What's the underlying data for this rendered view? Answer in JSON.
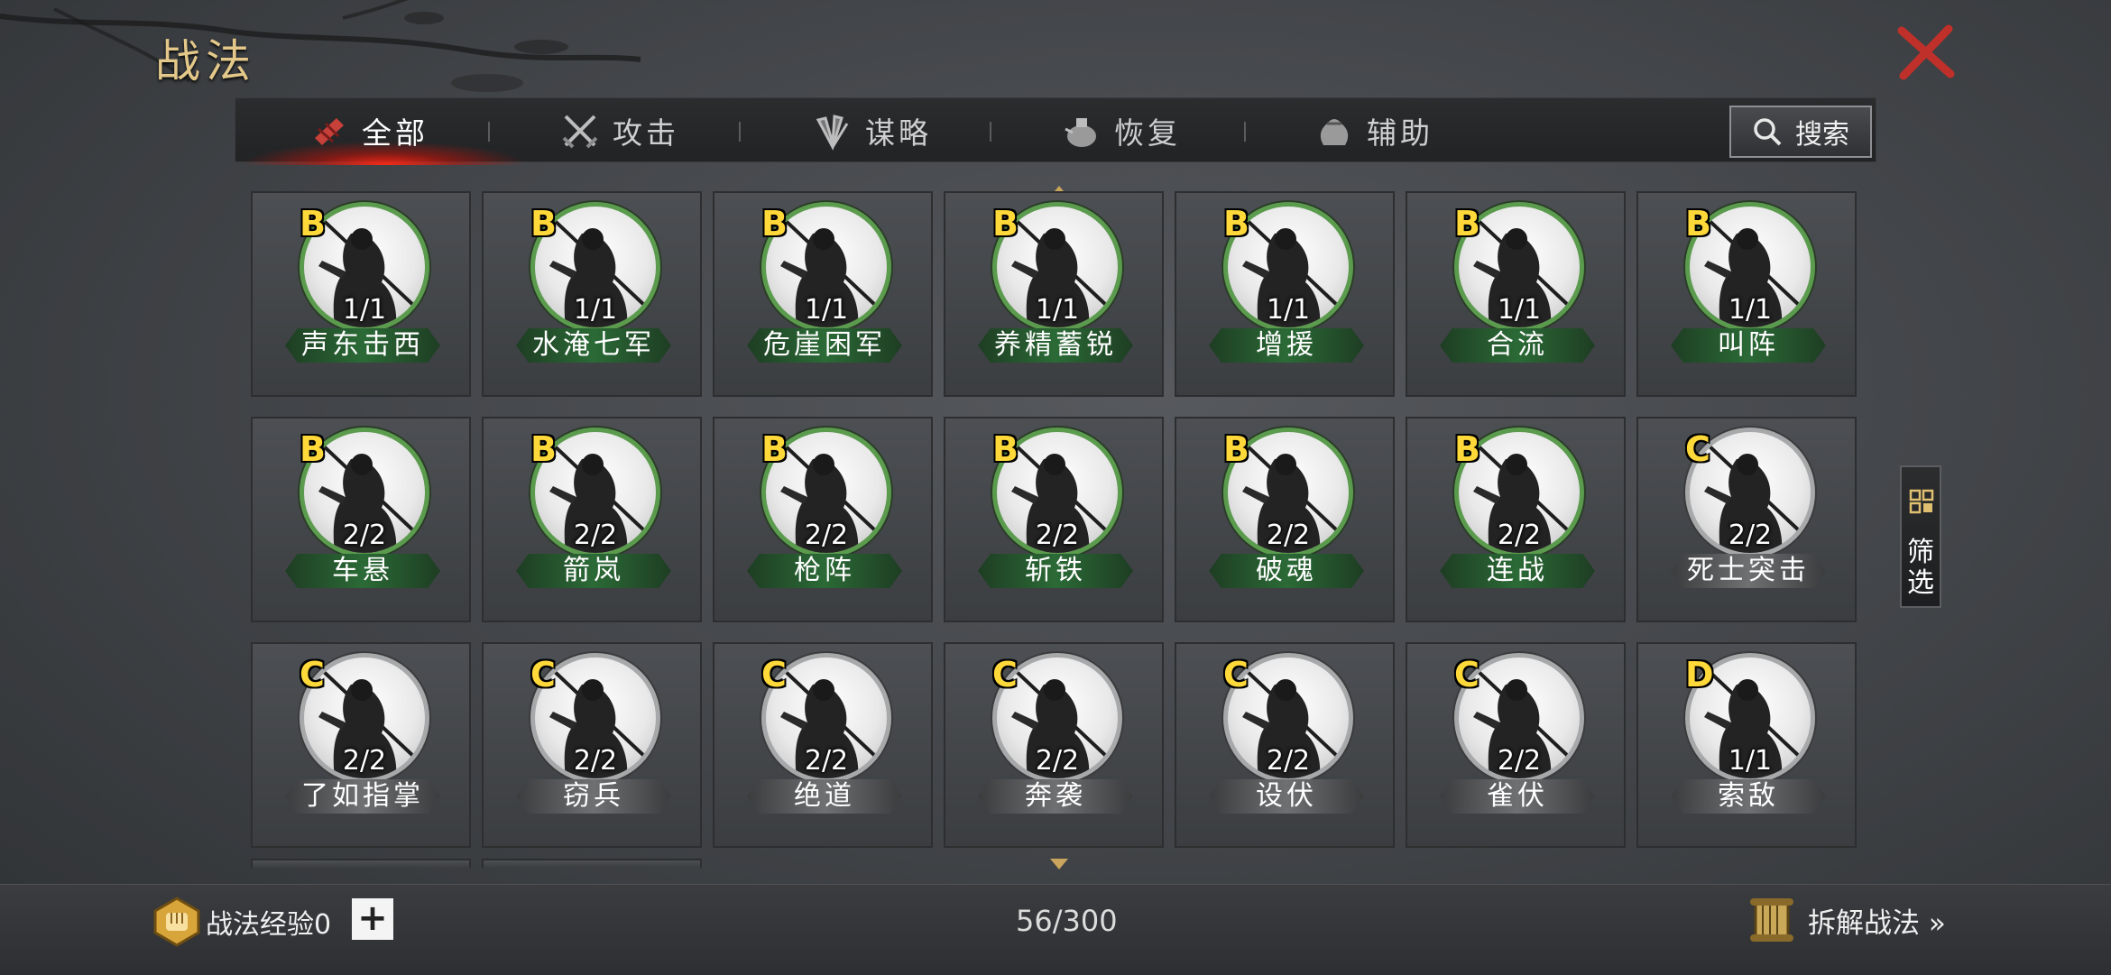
{
  "title": "战法",
  "tabs": [
    {
      "label": "全部",
      "icon": "all-bundle-icon",
      "active": true
    },
    {
      "label": "攻击",
      "icon": "crossed-swords-icon",
      "active": false
    },
    {
      "label": "谋略",
      "icon": "wing-fan-icon",
      "active": false
    },
    {
      "label": "恢复",
      "icon": "medicine-pot-icon",
      "active": false
    },
    {
      "label": "辅助",
      "icon": "pouch-icon",
      "active": false
    }
  ],
  "search_label": "搜索",
  "filter_label": "筛选",
  "tactics": [
    {
      "grade": "B",
      "level": "1/1",
      "name": "声东击西",
      "frame": "green"
    },
    {
      "grade": "B",
      "level": "1/1",
      "name": "水淹七军",
      "frame": "green"
    },
    {
      "grade": "B",
      "level": "1/1",
      "name": "危崖困军",
      "frame": "green"
    },
    {
      "grade": "B",
      "level": "1/1",
      "name": "养精蓄锐",
      "frame": "green"
    },
    {
      "grade": "B",
      "level": "1/1",
      "name": "增援",
      "frame": "green"
    },
    {
      "grade": "B",
      "level": "1/1",
      "name": "合流",
      "frame": "green"
    },
    {
      "grade": "B",
      "level": "1/1",
      "name": "叫阵",
      "frame": "green"
    },
    {
      "grade": "B",
      "level": "2/2",
      "name": "车悬",
      "frame": "green"
    },
    {
      "grade": "B",
      "level": "2/2",
      "name": "箭岚",
      "frame": "green"
    },
    {
      "grade": "B",
      "level": "2/2",
      "name": "枪阵",
      "frame": "green"
    },
    {
      "grade": "B",
      "level": "2/2",
      "name": "斩铁",
      "frame": "green"
    },
    {
      "grade": "B",
      "level": "2/2",
      "name": "破魂",
      "frame": "green"
    },
    {
      "grade": "B",
      "level": "2/2",
      "name": "连战",
      "frame": "green"
    },
    {
      "grade": "C",
      "level": "2/2",
      "name": "死士突击",
      "frame": "grey"
    },
    {
      "grade": "C",
      "level": "2/2",
      "name": "了如指掌",
      "frame": "grey"
    },
    {
      "grade": "C",
      "level": "2/2",
      "name": "窃兵",
      "frame": "grey"
    },
    {
      "grade": "C",
      "level": "2/2",
      "name": "绝道",
      "frame": "grey"
    },
    {
      "grade": "C",
      "level": "2/2",
      "name": "奔袭",
      "frame": "grey"
    },
    {
      "grade": "C",
      "level": "2/2",
      "name": "设伏",
      "frame": "grey"
    },
    {
      "grade": "C",
      "level": "2/2",
      "name": "雀伏",
      "frame": "grey"
    },
    {
      "grade": "D",
      "level": "1/1",
      "name": "索敌",
      "frame": "grey"
    }
  ],
  "footer": {
    "exp_label": "战法经验0",
    "plus_label": "+",
    "count": "56/300",
    "dismantle_label": "拆解战法 »"
  },
  "colors": {
    "title_gold": "#e3c88a",
    "close_red": "#c0302a",
    "grade_yellow": "#ffd83a",
    "frame_green": "#5b9b4d",
    "frame_grey": "#a6a8aa",
    "active_tab_glow": "#ff2814"
  }
}
